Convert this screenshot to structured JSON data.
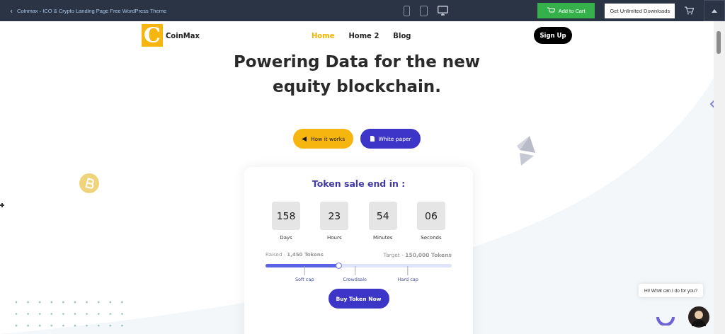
{
  "top_bar": {
    "back_icon": "‹",
    "title": "Coinmax - ICO & Crypto Landing Page Free WordPress Theme",
    "add_to_cart": "Add to Cart",
    "unlimited": "Get Unlimited Downloads"
  },
  "nav": {
    "logo_letter": "C",
    "logo_text": "CoinMax",
    "links": [
      {
        "label": "Home",
        "selected": true
      },
      {
        "label": "Home 2",
        "selected": false
      },
      {
        "label": "Blog",
        "selected": false
      }
    ],
    "signup": "Sign Up"
  },
  "hero": {
    "lines": [
      "Powering Data for the new",
      "equity blockchain."
    ],
    "buttons": [
      {
        "label": "How it works",
        "kind": "primary"
      },
      {
        "label": "White paper",
        "kind": "secondary"
      }
    ]
  },
  "token_card": {
    "title": "Token sale end in :",
    "countdown": [
      {
        "value": "158",
        "unit": "Days"
      },
      {
        "value": "23",
        "unit": "Hours"
      },
      {
        "value": "54",
        "unit": "Minutes"
      },
      {
        "value": "06",
        "unit": "Seconds"
      }
    ],
    "raised": "Raised - **1,450 Tokens**",
    "target": "Target - **150,000 Tokens**",
    "progress": {
      "level": 0.39
    },
    "markers": [
      "Soft cap",
      "Crowdsale",
      "Hard cap"
    ],
    "buy": "Buy Token Now"
  },
  "chat": {
    "message": "Hi! What can I do for you?"
  }
}
